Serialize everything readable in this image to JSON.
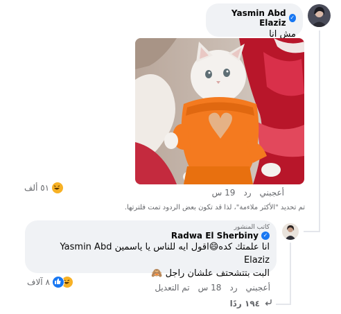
{
  "comment1": {
    "author": "Yasmin Abd Elaziz",
    "text": "مش انا",
    "time": "19 س",
    "reply": "رد",
    "like": "أعجبني",
    "reaction_count": "٥١ ألف"
  },
  "notice": "تم تحديد \"الأكثر ملاءمة\"، لذا قد تكون بعض الردود تمت فلترتها.",
  "comment2": {
    "author_badge": "كاتب المنشور",
    "author": "Radwa El Sherbiny",
    "line1": "انا علمتك كده😄اقول ايه للناس يا ياسمين Yasmin Abd Elaziz",
    "line2": "البت بتتشحتف علشان راجل 🙈",
    "time": "18 س",
    "reply": "رد",
    "like": "أعجبني",
    "edited": "تم التعديل",
    "reaction_count": "٨ آلاف"
  },
  "replies_link": "١٩٤ ردًا",
  "icons": {
    "verified": "verified-badge-icon",
    "haha": "haha-reaction-icon",
    "like": "like-reaction-icon",
    "reply_arrow": "reply-arrow-icon"
  },
  "colors": {
    "bubble": "#f0f2f5",
    "verified": "#1877f2",
    "secondary_text": "#65676b",
    "haha": "#f7b125"
  }
}
